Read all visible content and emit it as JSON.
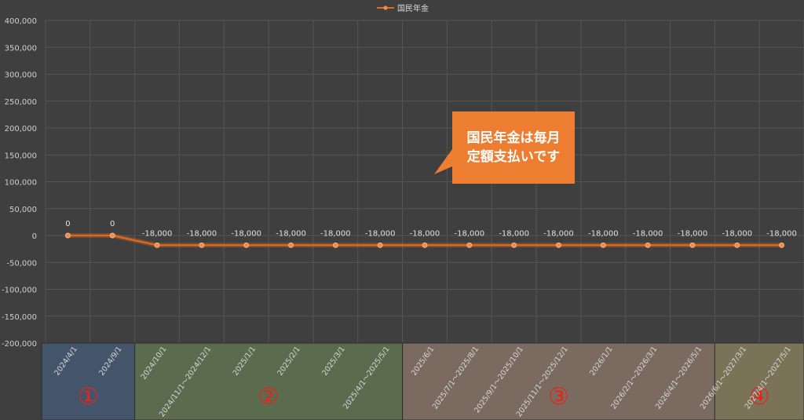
{
  "chart_data": {
    "type": "line",
    "legend": {
      "position": "top",
      "label": "国民年金"
    },
    "series": [
      {
        "name": "国民年金",
        "color": "#e8681a",
        "values": [
          0,
          0,
          -18000,
          -18000,
          -18000,
          -18000,
          -18000,
          -18000,
          -18000,
          -18000,
          -18000,
          -18000,
          -18000,
          -18000,
          -18000,
          -18000,
          -18000
        ]
      }
    ],
    "data_labels": [
      "0",
      "0",
      "-18,000",
      "-18,000",
      "-18,000",
      "-18,000",
      "-18,000",
      "-18,000",
      "-18,000",
      "-18,000",
      "-18,000",
      "-18,000",
      "-18,000",
      "-18,000",
      "-18,000",
      "-18,000",
      "-18,000"
    ],
    "ylim": [
      -200000,
      400000
    ],
    "yticks": [
      "400,000",
      "350,000",
      "300,000",
      "250,000",
      "200,000",
      "150,000",
      "100,000",
      "50,000",
      "0",
      "-50,000",
      "-100,000",
      "-150,000",
      "-200,000"
    ],
    "categories": [
      "2024/4/1",
      "2024/9/1",
      "2024/10/1",
      "2024/11/1～2024/12/1",
      "2025/1/1",
      "2025/2/1",
      "2025/3/1",
      "2025/4/1～2025/5/1",
      "2025/6/1",
      "2025/7/1～2025/8/1",
      "2025/9/1～2025/10/1",
      "2025/11/1～2025/12/1",
      "2026/1/1",
      "2026/2/1～2026/3/1",
      "2026/4/1～2026/5/1",
      "2026/6/1～2027/3/1",
      "2027/4/1～2027/5/1"
    ],
    "grid": true
  },
  "periods": [
    {
      "label": "①",
      "color": "#44546a",
      "start": 0,
      "end": 1
    },
    {
      "label": "②",
      "color": "#5a6b4e",
      "start": 2,
      "end": 7
    },
    {
      "label": "③",
      "color": "#7a6a60",
      "start": 8,
      "end": 14
    },
    {
      "label": "④",
      "color": "#7a7358",
      "start": 15,
      "end": 16
    }
  ],
  "callout": {
    "lines": [
      "国民年金は毎月",
      "定額支払いです"
    ],
    "color": "#ed7d31"
  }
}
